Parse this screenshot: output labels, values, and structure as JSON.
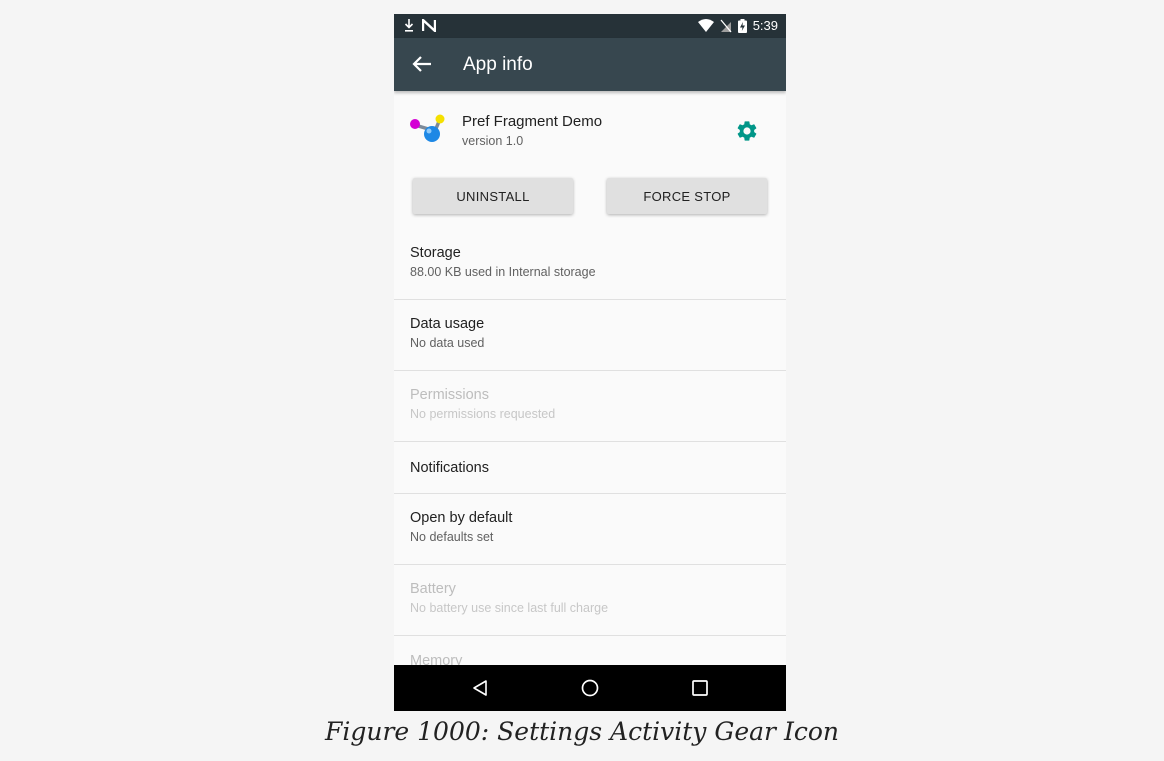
{
  "status_bar": {
    "time": "5:39",
    "left_icons": [
      "download-icon",
      "n-logo-icon"
    ],
    "right_icons": [
      "wifi-icon",
      "no-sim-icon",
      "battery-charging-icon"
    ]
  },
  "app_bar": {
    "title": "App info",
    "back_icon": "arrow-back-icon"
  },
  "app_header": {
    "name": "Pref Fragment Demo",
    "version": "version 1.0",
    "settings_icon": "gear-icon",
    "accent_color": "#009688"
  },
  "buttons": {
    "uninstall": "UNINSTALL",
    "force_stop": "FORCE STOP"
  },
  "prefs": {
    "storage": {
      "title": "Storage",
      "summary": "88.00 KB used in Internal storage"
    },
    "data_usage": {
      "title": "Data usage",
      "summary": "No data used"
    },
    "permissions": {
      "title": "Permissions",
      "summary": "No permissions requested",
      "enabled": false
    },
    "notifications": {
      "title": "Notifications"
    },
    "open_by_default": {
      "title": "Open by default",
      "summary": "No defaults set"
    },
    "battery": {
      "title": "Battery",
      "summary": "No battery use since last full charge",
      "enabled": false
    },
    "memory": {
      "title": "Memory",
      "enabled": false
    }
  },
  "nav_bar": {
    "icons": [
      "back-triangle-icon",
      "home-circle-icon",
      "recents-square-icon"
    ]
  },
  "caption": "Figure 1000: Settings Activity Gear Icon",
  "colors": {
    "status_bar": "#263238",
    "app_bar": "#37474f",
    "background": "#fafafa"
  }
}
